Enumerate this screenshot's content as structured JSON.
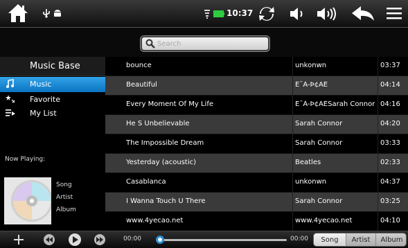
{
  "status": {
    "time": "10:37",
    "icons": [
      "home-icon",
      "usb-icon",
      "android-icon",
      "wifi-icon",
      "battery-icon",
      "refresh-icon",
      "volume-down-icon",
      "volume-up-icon",
      "back-icon",
      "menu-icon"
    ]
  },
  "search": {
    "placeholder": "Search"
  },
  "sidebar": {
    "header": "Music Base",
    "items": [
      {
        "label": "Music",
        "icon": "music-note-icon",
        "active": true
      },
      {
        "label": "Favorite",
        "icon": "star-icon",
        "active": false
      },
      {
        "label": "My List",
        "icon": "playlist-icon",
        "active": false
      }
    ]
  },
  "now_playing": {
    "title": "Now Playing:",
    "song": "Song",
    "artist": "Artist",
    "album": "Album"
  },
  "tracks": [
    {
      "title": "bounce",
      "artist": "unkonwn",
      "duration": "03:37"
    },
    {
      "title": "Beautiful",
      "artist": "É¯À-Þ¢ÄÈ",
      "duration": "04:14"
    },
    {
      "title": "Every Moment Of My Life",
      "artist": "É¯À-Þ¢ÄÈSarah Connor",
      "duration": "04:16"
    },
    {
      "title": "He S Unbelievable",
      "artist": "Sarah Connor",
      "duration": "04:20"
    },
    {
      "title": "The Impossible Dream",
      "artist": "Sarah Connor",
      "duration": "03:33"
    },
    {
      "title": "Yesterday (acoustic)",
      "artist": "Beatles",
      "duration": "02:33"
    },
    {
      "title": "Casablanca",
      "artist": "unkonwn",
      "duration": "04:37"
    },
    {
      "title": "I Wanna Touch U There",
      "artist": "Sarah Connor",
      "duration": "03:25"
    },
    {
      "title": "www.4yecao.net",
      "artist": "www.4yecao.net",
      "duration": "04:10"
    }
  ],
  "player": {
    "elapsed": "00:00",
    "total": "00:00",
    "progress": 0.0,
    "sort_tabs": [
      {
        "label": "Song",
        "active": true
      },
      {
        "label": "Artist",
        "active": false
      },
      {
        "label": "Album",
        "active": false
      }
    ]
  },
  "colors": {
    "accent": "#1e8fde",
    "row_alt": "#3a3a3a",
    "battery": "#2ecc40"
  }
}
